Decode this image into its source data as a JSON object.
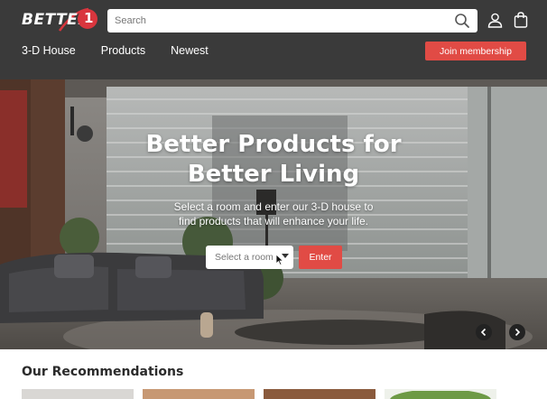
{
  "header": {
    "logo_text": "BETTER",
    "logo_mark": "1",
    "search": {
      "placeholder": "Search"
    },
    "icons": {
      "search": "search-icon",
      "user": "user-icon",
      "bag": "shopping-bag-icon"
    },
    "nav": [
      {
        "label": "3-D House"
      },
      {
        "label": "Products"
      },
      {
        "label": "Newest"
      }
    ],
    "join_label": "Join membership"
  },
  "hero": {
    "title_line1": "Better Products for",
    "title_line2": "Better Living",
    "subtitle_line1": "Select a room and enter our 3-D house to",
    "subtitle_line2": "find products that will enhance your life.",
    "select_placeholder": "Select a room",
    "enter_label": "Enter",
    "prev_icon": "chevron-left-icon",
    "next_icon": "chevron-right-icon"
  },
  "recommendations": {
    "title": "Our Recommendations"
  },
  "colors": {
    "header_bg": "#3a3a3a",
    "accent": "#e14b45",
    "logo_red": "#d9363e"
  }
}
